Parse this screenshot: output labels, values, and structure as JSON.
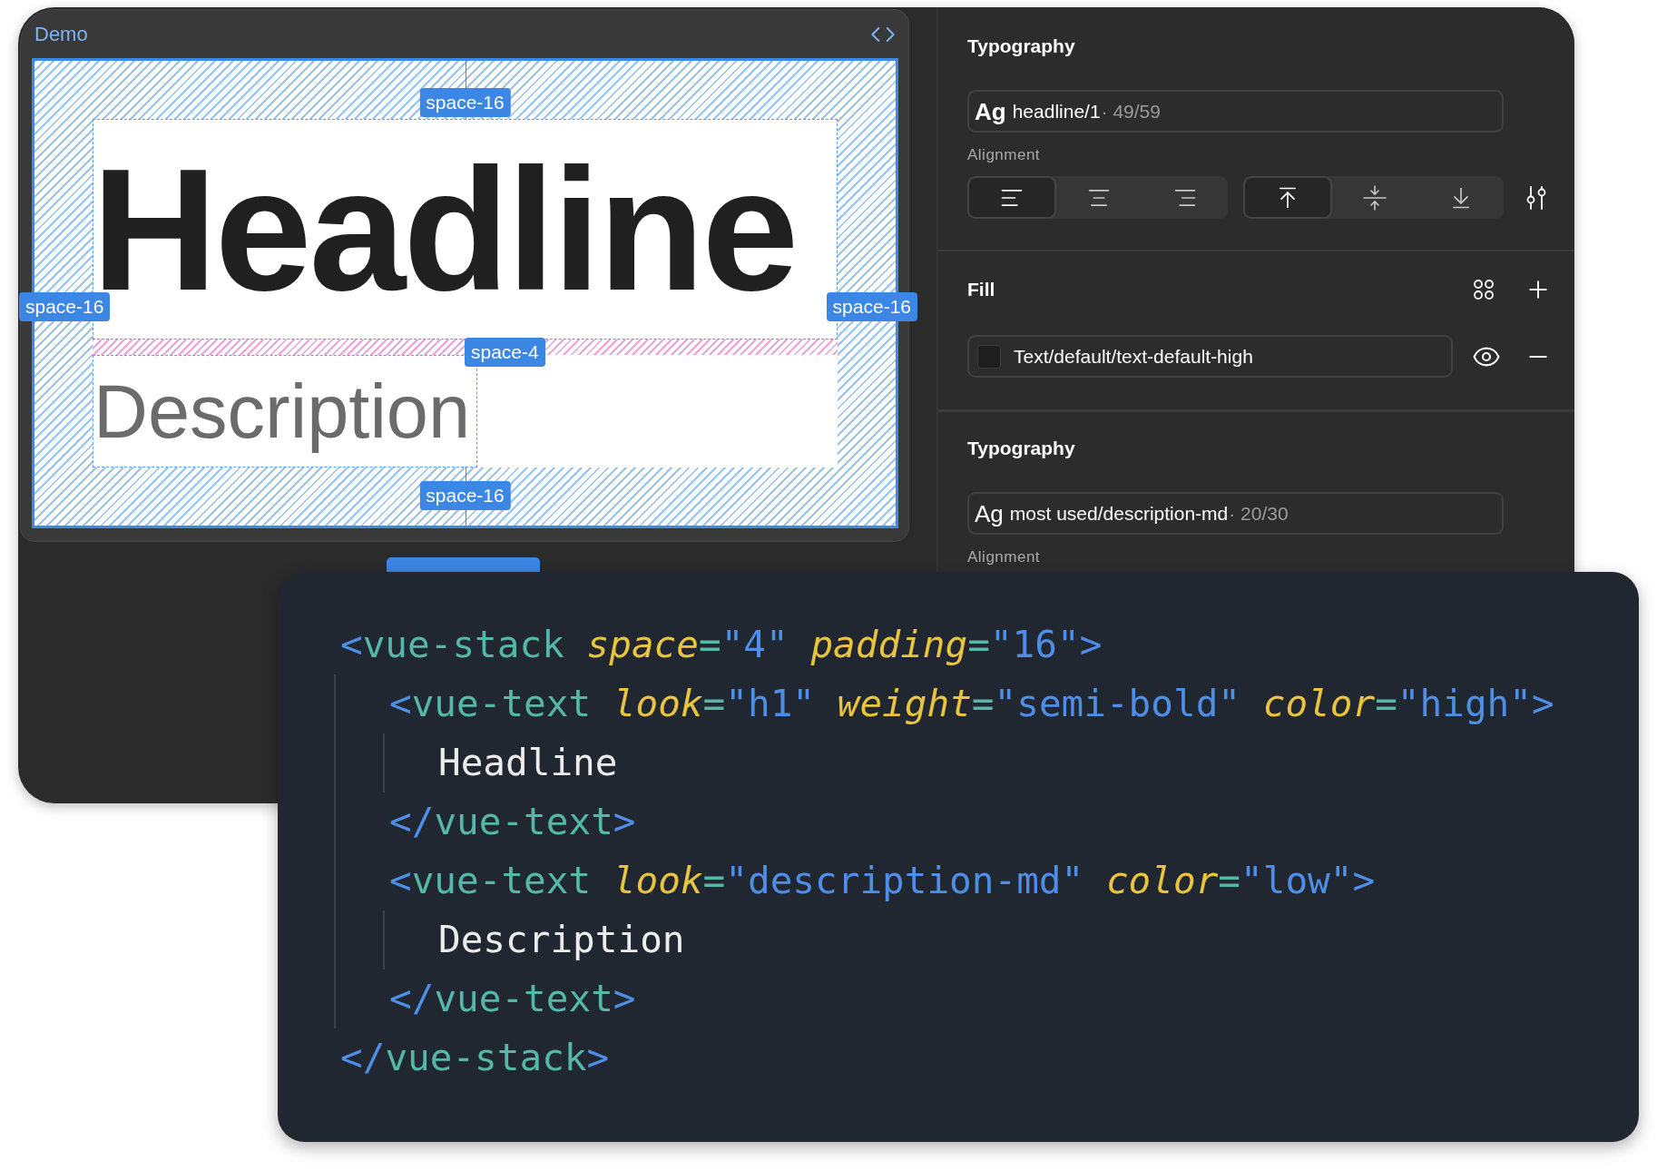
{
  "demo": {
    "title": "Demo",
    "headline": "Headline",
    "description": "Description",
    "badges": [
      {
        "kind": "top",
        "text": "space-16"
      },
      {
        "kind": "left",
        "text": "space-16"
      },
      {
        "kind": "right",
        "text": "space-16"
      },
      {
        "kind": "gap",
        "text": "space-4"
      },
      {
        "kind": "bottom",
        "text": "space-16"
      }
    ]
  },
  "inspector": {
    "sections": [
      {
        "kind": "typography",
        "title": "Typography",
        "style": {
          "ag": "Ag",
          "ag_bold": true,
          "name": "headline/1",
          "metrics": "· 49/59"
        },
        "alignment_label": "Alignment",
        "horizontal": [
          {
            "kind": "left",
            "selected": true
          },
          {
            "kind": "center",
            "selected": false
          },
          {
            "kind": "right",
            "selected": false
          }
        ],
        "vertical": [
          {
            "kind": "top",
            "selected": true
          },
          {
            "kind": "middle",
            "selected": false
          },
          {
            "kind": "bottom",
            "selected": false
          }
        ]
      },
      {
        "kind": "fill",
        "title": "Fill",
        "value": "Text/default/text-default-high"
      },
      {
        "kind": "typography",
        "title": "Typography",
        "style": {
          "ag": "Ag",
          "ag_bold": false,
          "name": "most used/description-md",
          "metrics": "· 20/30"
        },
        "alignment_label": "Alignment"
      }
    ]
  },
  "code": {
    "open": [
      {
        "kind": "punct",
        "text": "<"
      },
      {
        "kind": "tag",
        "text": "vue-stack"
      },
      {
        "kind": "attr",
        "text": " space"
      },
      {
        "kind": "eq",
        "text": "="
      },
      {
        "kind": "string",
        "text": "\"4\""
      },
      {
        "kind": "attr",
        "text": " padding"
      },
      {
        "kind": "eq",
        "text": "="
      },
      {
        "kind": "string",
        "text": "\"16\""
      },
      {
        "kind": "punct",
        "text": ">"
      }
    ],
    "children": [
      {
        "open": [
          {
            "kind": "punct",
            "text": "<"
          },
          {
            "kind": "tag",
            "text": "vue-text"
          },
          {
            "kind": "attr",
            "text": " look"
          },
          {
            "kind": "eq",
            "text": "="
          },
          {
            "kind": "string",
            "text": "\"h1\""
          },
          {
            "kind": "attr",
            "text": " weight"
          },
          {
            "kind": "eq",
            "text": "="
          },
          {
            "kind": "string",
            "text": "\"semi-bold\""
          },
          {
            "kind": "attr",
            "text": " color"
          },
          {
            "kind": "eq",
            "text": "="
          },
          {
            "kind": "string",
            "text": "\"high\""
          },
          {
            "kind": "punct",
            "text": ">"
          }
        ],
        "children": [
          {
            "text": "Headline"
          }
        ],
        "close": [
          {
            "kind": "punct",
            "text": "</"
          },
          {
            "kind": "tag",
            "text": "vue-text"
          },
          {
            "kind": "punct",
            "text": ">"
          }
        ]
      },
      {
        "open": [
          {
            "kind": "punct",
            "text": "<"
          },
          {
            "kind": "tag",
            "text": "vue-text"
          },
          {
            "kind": "attr",
            "text": " look"
          },
          {
            "kind": "eq",
            "text": "="
          },
          {
            "kind": "string",
            "text": "\"description-md\""
          },
          {
            "kind": "attr",
            "text": " color"
          },
          {
            "kind": "eq",
            "text": "="
          },
          {
            "kind": "string",
            "text": "\"low\""
          },
          {
            "kind": "punct",
            "text": ">"
          }
        ],
        "children": [
          {
            "text": "Description"
          }
        ],
        "close": [
          {
            "kind": "punct",
            "text": "</"
          },
          {
            "kind": "tag",
            "text": "vue-text"
          },
          {
            "kind": "punct",
            "text": ">"
          }
        ]
      }
    ],
    "close": [
      {
        "kind": "punct",
        "text": "</"
      },
      {
        "kind": "tag",
        "text": "vue-stack"
      },
      {
        "kind": "punct",
        "text": ">"
      }
    ]
  }
}
